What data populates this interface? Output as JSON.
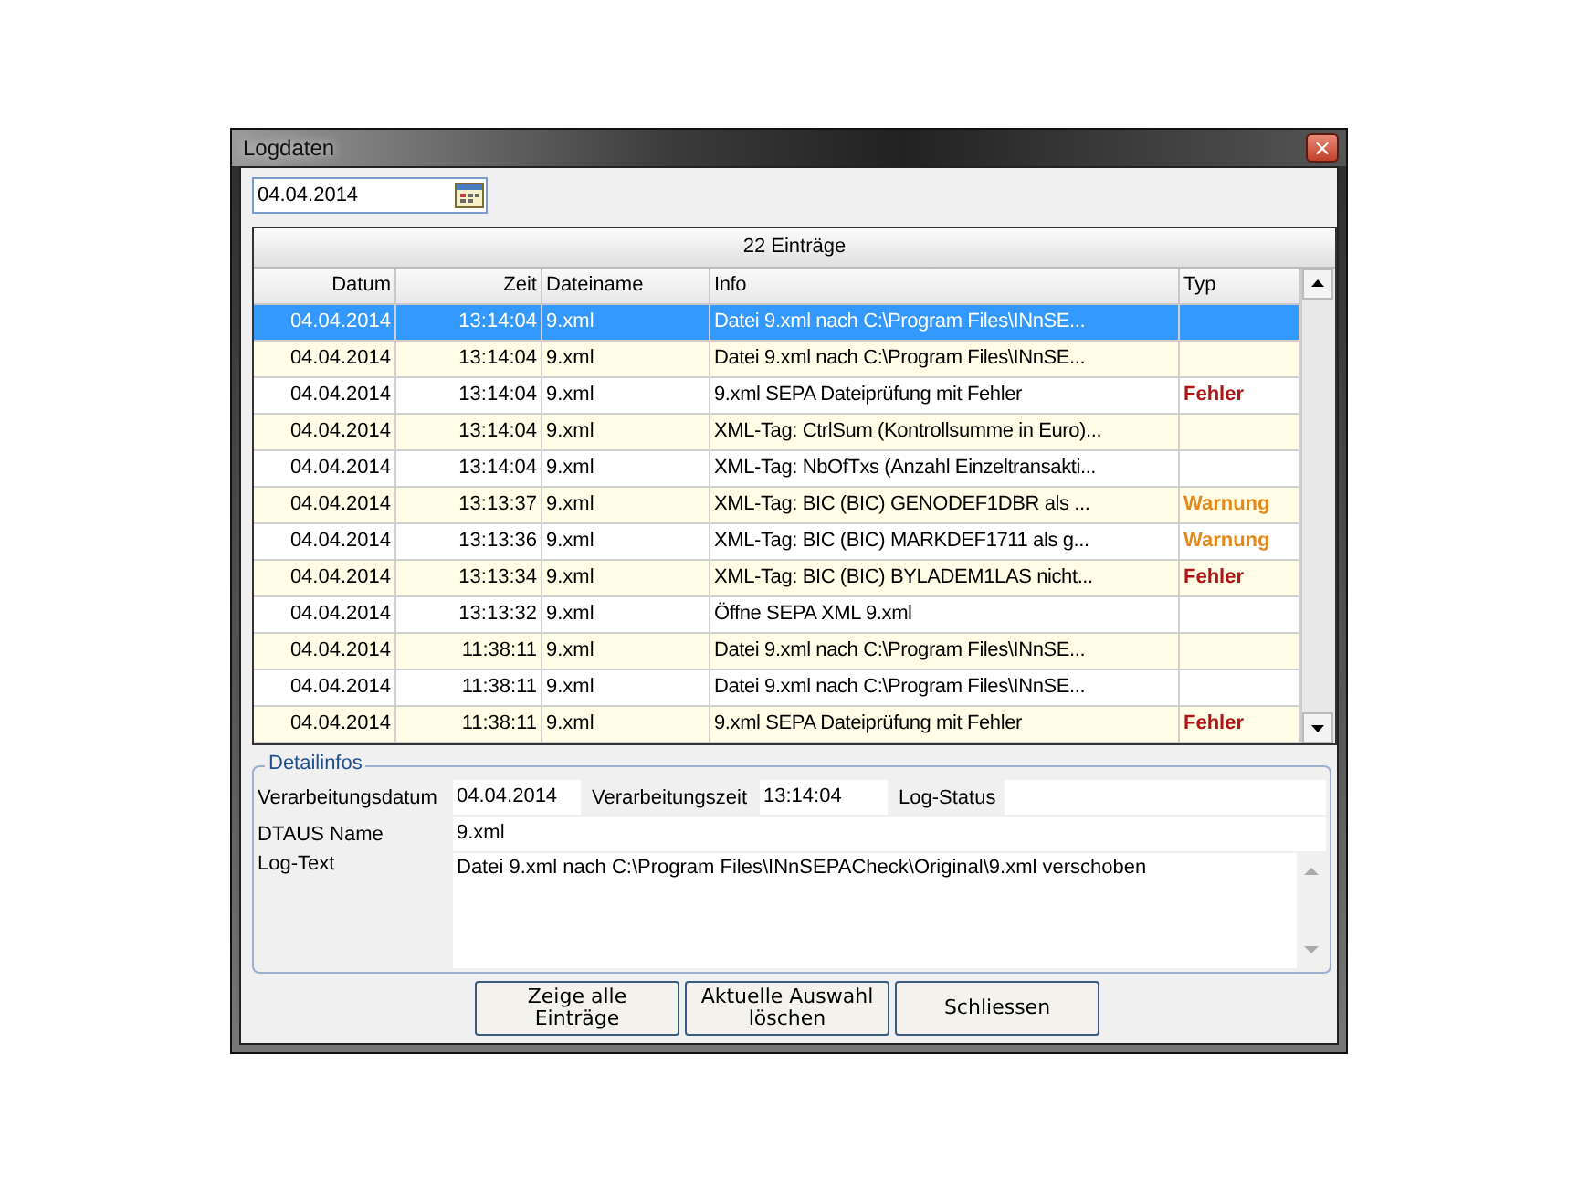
{
  "window": {
    "title": "Logdaten",
    "close": "×"
  },
  "date_field": {
    "value": "04.04.2014"
  },
  "table": {
    "caption": "22 Einträge",
    "columns": [
      "Datum",
      "Zeit",
      "Dateiname",
      "Info",
      "Typ"
    ],
    "rows": [
      {
        "datum": "04.04.2014",
        "zeit": "13:14:04",
        "dateiname": "9.xml",
        "info": "Datei 9.xml nach C:\\Program Files\\INnSE...",
        "selected": true
      },
      {
        "datum": "04.04.2014",
        "zeit": "13:14:04",
        "dateiname": "9.xml",
        "info": "Datei 9.xml nach C:\\Program Files\\INnSE...",
        "selected": false
      },
      {
        "datum": "04.04.2014",
        "zeit": "13:14:04",
        "dateiname": "9.xml",
        "info": "9.xml SEPA Dateiprüfung mit Fehler",
        "typ": "Fehler",
        "kind": "error",
        "selected": false
      },
      {
        "datum": "04.04.2014",
        "zeit": "13:14:04",
        "dateiname": "9.xml",
        "info": "XML-Tag: CtrlSum (Kontrollsumme in Euro)...",
        "selected": false
      },
      {
        "datum": "04.04.2014",
        "zeit": "13:14:04",
        "dateiname": "9.xml",
        "info": "XML-Tag: NbOfTxs (Anzahl Einzeltransakti...",
        "selected": false
      },
      {
        "datum": "04.04.2014",
        "zeit": "13:13:37",
        "dateiname": "9.xml",
        "info": "XML-Tag: BIC (BIC) GENODEF1DBR als ...",
        "typ": "Warnung",
        "kind": "warning",
        "selected": false
      },
      {
        "datum": "04.04.2014",
        "zeit": "13:13:36",
        "dateiname": "9.xml",
        "info": "XML-Tag: BIC (BIC) MARKDEF1711 als g...",
        "typ": "Warnung",
        "kind": "warning",
        "selected": false
      },
      {
        "datum": "04.04.2014",
        "zeit": "13:13:34",
        "dateiname": "9.xml",
        "info": "XML-Tag: BIC (BIC) BYLADEM1LAS nicht...",
        "typ": "Fehler",
        "kind": "error",
        "selected": false
      },
      {
        "datum": "04.04.2014",
        "zeit": "13:13:32",
        "dateiname": "9.xml",
        "info": "Öffne SEPA XML 9.xml",
        "selected": false
      },
      {
        "datum": "04.04.2014",
        "zeit": "11:38:11",
        "dateiname": "9.xml",
        "info": "Datei 9.xml nach C:\\Program Files\\INnSE...",
        "selected": false
      },
      {
        "datum": "04.04.2014",
        "zeit": "11:38:11",
        "dateiname": "9.xml",
        "info": "Datei 9.xml nach C:\\Program Files\\INnSE...",
        "selected": false
      },
      {
        "datum": "04.04.2014",
        "zeit": "11:38:11",
        "dateiname": "9.xml",
        "info": "9.xml SEPA Dateiprüfung mit Fehler",
        "typ": "Fehler",
        "kind": "error",
        "selected": false
      }
    ]
  },
  "details": {
    "legend": "Detailinfos",
    "verarbeitungsdatum": {
      "label": "Verarbeitungsdatum",
      "value": "04.04.2014"
    },
    "verarbeitungszeit": {
      "label": "Verarbeitungszeit",
      "value": "13:14:04"
    },
    "log_status": {
      "label": "Log-Status"
    },
    "dtaus_name": {
      "label": "DTAUS Name",
      "value": "9.xml"
    },
    "log_text": {
      "label": "Log-Text",
      "value": "Datei 9.xml nach C:\\Program Files\\INnSEPACheck\\Original\\9.xml verschoben"
    }
  },
  "buttons": [
    {
      "lines": [
        "Zeige alle",
        "Einträge"
      ]
    },
    {
      "lines": [
        "Aktuelle Auswahl",
        "löschen"
      ]
    },
    {
      "lines": [
        "Schliessen"
      ]
    }
  ]
}
